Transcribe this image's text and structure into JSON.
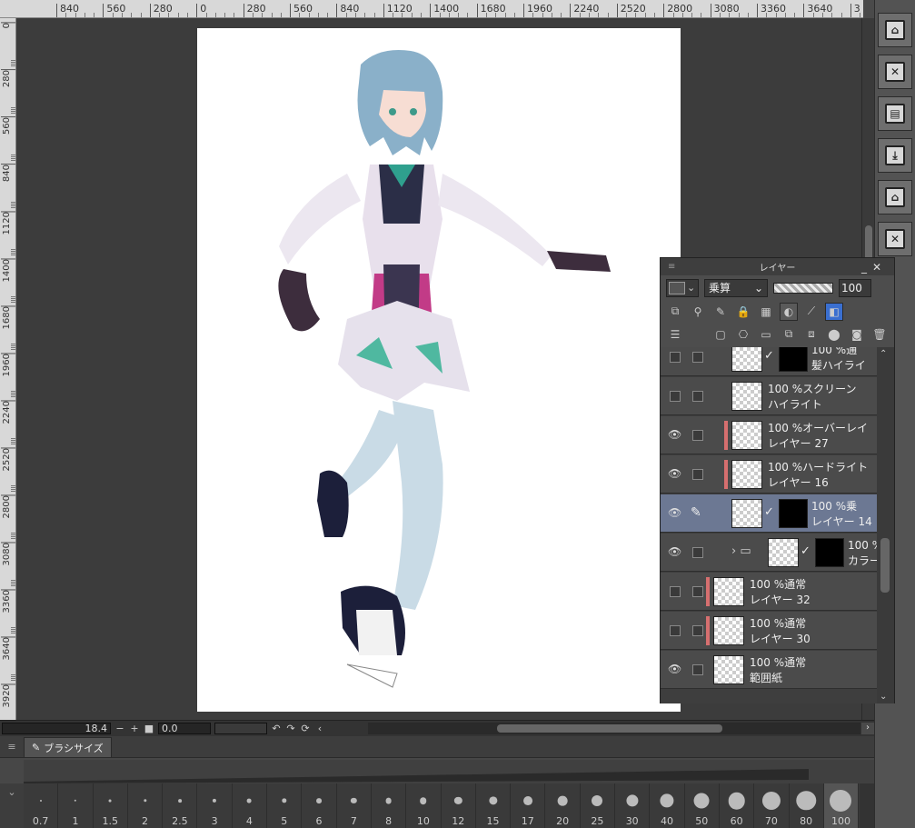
{
  "ruler": {
    "horizontal_ticks": [
      "840",
      "560",
      "280",
      "0",
      "280",
      "560",
      "840",
      "1120",
      "1400",
      "1680",
      "1960",
      "2240",
      "2520",
      "2800",
      "3080",
      "3360",
      "3640",
      "3"
    ],
    "vertical_ticks": [
      "0",
      "280",
      "560",
      "840",
      "1120",
      "1400",
      "1680",
      "1960",
      "2240",
      "2520",
      "2800",
      "3080",
      "3360",
      "3640",
      "3920"
    ]
  },
  "status": {
    "zoom": "18.4",
    "minus": "−",
    "plus": "+",
    "stop": "■",
    "rotation": "0.0"
  },
  "brush_panel": {
    "tab_label": "ブラシサイズ",
    "sizes": [
      "0.7",
      "1",
      "1.5",
      "2",
      "2.5",
      "3",
      "4",
      "5",
      "6",
      "7",
      "8",
      "10",
      "12",
      "15",
      "17",
      "20",
      "25",
      "30",
      "40",
      "50",
      "60",
      "70",
      "80",
      "100"
    ]
  },
  "layer_panel": {
    "title": "レイヤー",
    "blend_mode": "乗算",
    "opacity": "100",
    "layers": [
      {
        "line1": "100 %通",
        "line2": "髪ハイライ",
        "visible": false,
        "clip": false,
        "mask": true
      },
      {
        "line1": "100 %スクリーン",
        "line2": "ハイライト",
        "visible": false,
        "clip": false,
        "mask": false
      },
      {
        "line1": "100 %オーバーレイ",
        "line2": "レイヤー 27",
        "visible": true,
        "clip": true,
        "mask": false
      },
      {
        "line1": "100 %ハードライト",
        "line2": "レイヤー 16",
        "visible": true,
        "clip": true,
        "mask": false
      },
      {
        "line1": "100 %乗",
        "line2": "レイヤー 14",
        "visible": true,
        "clip": false,
        "mask": true,
        "selected": true
      },
      {
        "line1": "100 %通",
        "line2": "カラー",
        "visible": true,
        "clip": false,
        "mask": true,
        "folder": true
      },
      {
        "line1": "100 %通常",
        "line2": "レイヤー 32",
        "visible": false,
        "clip": true,
        "mask": false
      },
      {
        "line1": "100 %通常",
        "line2": "レイヤー 30",
        "visible": false,
        "clip": true,
        "mask": false
      },
      {
        "line1": "100 %通常",
        "line2": "範囲紙",
        "visible": true,
        "clip": false,
        "mask": false
      }
    ]
  },
  "colors": {
    "accent_selected": "#6c7893",
    "clip_marker": "#d66f6f"
  }
}
